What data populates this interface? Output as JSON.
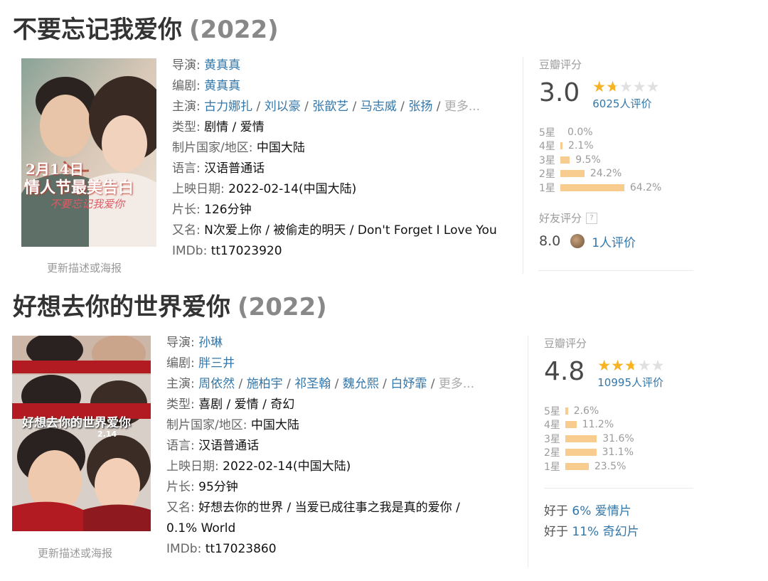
{
  "movies": [
    {
      "title": "不要忘记我爱你",
      "year": "(2022)",
      "update_link": "更新描述或海报",
      "director_label": "导演:",
      "director": "黄真真",
      "writer_label": "编剧:",
      "writer": "黄真真",
      "cast_label": "主演:",
      "cast": [
        "古力娜扎",
        "刘以豪",
        "张歆艺",
        "马志威",
        "张扬"
      ],
      "more": "更多...",
      "genre_label": "类型:",
      "genre": "剧情 / 爱情",
      "country_label": "制片国家/地区:",
      "country": "中国大陆",
      "language_label": "语言:",
      "language": "汉语普通话",
      "release_label": "上映日期:",
      "release": "2022-02-14(中国大陆)",
      "runtime_label": "片长:",
      "runtime": "126分钟",
      "aka_label": "又名:",
      "aka": "N次爱上你 / 被偷走的明天 / Don't Forget I Love You",
      "imdb_label": "IMDb:",
      "imdb": "tt17023920",
      "poster_text": {
        "date": "2月14日",
        "slogan": "情人节最美告白",
        "logo": "不要忘记我爱你"
      },
      "rating": {
        "head": "豆瓣评分",
        "score": "3.0",
        "stars_fraction": 0.3,
        "votes": "6025人评价",
        "dist": [
          {
            "label": "5星",
            "pct": "0.0%",
            "value": 0.0
          },
          {
            "label": "4星",
            "pct": "2.1%",
            "value": 2.1
          },
          {
            "label": "3星",
            "pct": "9.5%",
            "value": 9.5
          },
          {
            "label": "2星",
            "pct": "24.2%",
            "value": 24.2
          },
          {
            "label": "1星",
            "pct": "64.2%",
            "value": 64.2
          }
        ],
        "friend_head": "好友评分",
        "friend_help": "?",
        "friend_score": "8.0",
        "friend_votes": "1人评价"
      }
    },
    {
      "title": "好想去你的世界爱你",
      "year": "(2022)",
      "update_link": "更新描述或海报",
      "director_label": "导演:",
      "director": "孙琳",
      "writer_label": "编剧:",
      "writer": "胖三井",
      "cast_label": "主演:",
      "cast": [
        "周依然",
        "施柏宇",
        "祁圣翰",
        "魏允熙",
        "白妤霏"
      ],
      "more": "更多...",
      "genre_label": "类型:",
      "genre": "喜剧 / 爱情 / 奇幻",
      "country_label": "制片国家/地区:",
      "country": "中国大陆",
      "language_label": "语言:",
      "language": "汉语普通话",
      "release_label": "上映日期:",
      "release": "2022-02-14(中国大陆)",
      "runtime_label": "片长:",
      "runtime": "95分钟",
      "aka_label": "又名:",
      "aka_line1": "好想去你的世界 / 当爱已成往事之我是真的爱你 /",
      "aka_line2": "0.1% World",
      "imdb_label": "IMDb:",
      "imdb": "tt17023860",
      "poster_text": {
        "logo": "好想去你的世界爱你",
        "date": "2.14"
      },
      "rating": {
        "head": "豆瓣评分",
        "score": "4.8",
        "stars_fraction": 0.48,
        "votes": "10995人评价",
        "dist": [
          {
            "label": "5星",
            "pct": "2.6%",
            "value": 2.6
          },
          {
            "label": "4星",
            "pct": "11.2%",
            "value": 11.2
          },
          {
            "label": "3星",
            "pct": "31.6%",
            "value": 31.6
          },
          {
            "label": "2星",
            "pct": "31.1%",
            "value": 31.1
          },
          {
            "label": "1星",
            "pct": "23.5%",
            "value": 23.5
          }
        ],
        "better": [
          {
            "prefix": "好于",
            "pct": "6%",
            "genre": "爱情片"
          },
          {
            "prefix": "好于",
            "pct": "11%",
            "genre": "奇幻片"
          }
        ]
      }
    }
  ],
  "colors": {
    "link": "#3377aa",
    "star": "#f7b321",
    "bar": "#f8cc8f",
    "muted": "#9b9b9b"
  }
}
